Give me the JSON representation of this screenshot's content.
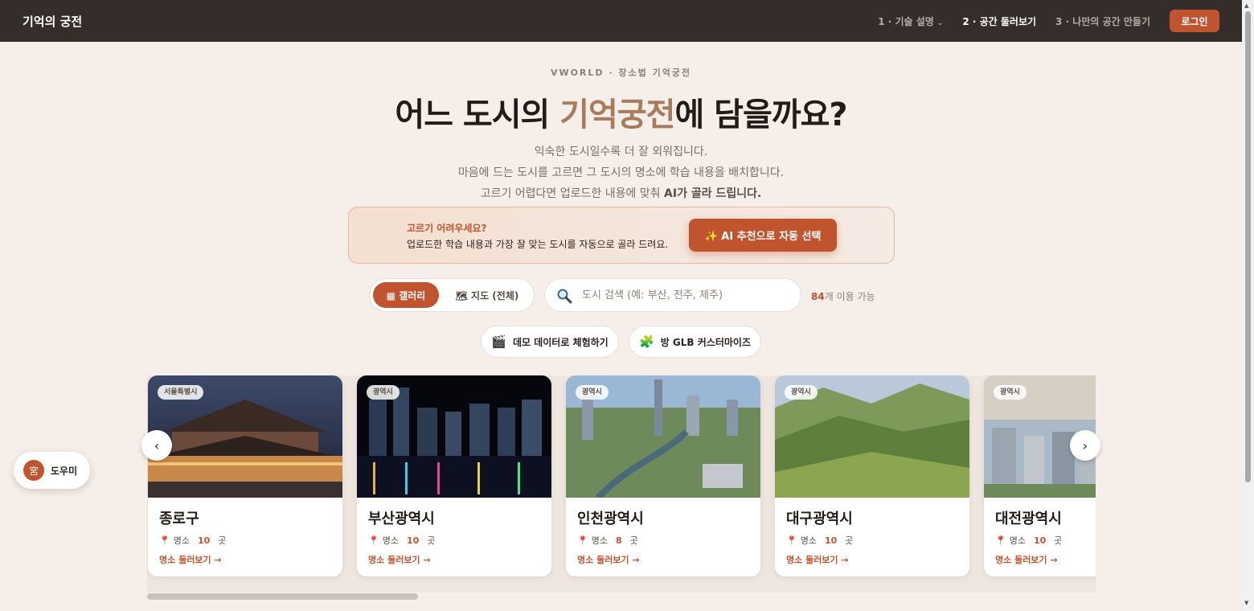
{
  "nav": {
    "brand": "기억의 궁전",
    "links": [
      {
        "label": "1 · 기술 설명",
        "caret": "⌄"
      },
      {
        "label": "2 · 공간 둘러보기"
      },
      {
        "label": "3 · 나만의 공간 만들기"
      }
    ],
    "login_label": "로그인"
  },
  "hero": {
    "eyebrow": "VWORLD · 장소법 기억궁전",
    "headline_pre": "어느 도시의 ",
    "headline_accent": "기억궁전",
    "headline_post": "에 담을까요?",
    "sub1": "익숙한 도시일수록 더 잘 외워집니다.",
    "sub2": "마음에 드는 도시를 고르면 그 도시의 명소에 학습 내용을 배치합니다.",
    "sub3_pre": "고르기 어렵다면 업로드한 내용에 맞춰 ",
    "sub3_strong": "AI가 골라 드립니다."
  },
  "ai_box": {
    "title": "고르기 어려우세요?",
    "desc": "업로드한 학습 내용과 가장 잘 맞는 도시를 자동으로 골라 드려요.",
    "button_icon": "✨",
    "button_label": "AI 추천으로 자동 선택"
  },
  "view_toggle": {
    "gallery_label": "▦ 갤러리",
    "map_label": "🗺 지도 (전체)"
  },
  "search": {
    "placeholder": "도시 검색 (예: 부산, 전주, 제주)",
    "value": ""
  },
  "availability": {
    "count": "84",
    "suffix": "개 이용 가능"
  },
  "actions": {
    "demo_icon": "🎬",
    "demo_label": "데모 데이터로 체험하기",
    "glb_icon": "🧩",
    "glb_label": "방 GLB 커스터마이즈"
  },
  "cards": [
    {
      "badge": "서울특별시",
      "name": "종로구",
      "meta_label": "명소",
      "count": "10",
      "unit": "곳",
      "link": "명소 둘러보기 →"
    },
    {
      "badge": "광역시",
      "name": "부산광역시",
      "meta_label": "명소",
      "count": "10",
      "unit": "곳",
      "link": "명소 둘러보기 →"
    },
    {
      "badge": "광역시",
      "name": "인천광역시",
      "meta_label": "명소",
      "count": "8",
      "unit": "곳",
      "link": "명소 둘러보기 →"
    },
    {
      "badge": "광역시",
      "name": "대구광역시",
      "meta_label": "명소",
      "count": "10",
      "unit": "곳",
      "link": "명소 둘러보기 →"
    },
    {
      "badge": "광역시",
      "name": "대전광역시",
      "meta_label": "명소",
      "count": "10",
      "unit": "곳",
      "link": "명소 둘러보기 →"
    }
  ],
  "carousel": {
    "prev": "‹",
    "next": "›"
  },
  "helper": {
    "avatar": "宮",
    "label": "도우미"
  },
  "icons": {
    "pin": "pin-icon",
    "search": "magnifier-icon"
  },
  "colors": {
    "accent": "#c0542e",
    "nav_bg": "#342d29",
    "page_bg": "#f6eee8"
  }
}
